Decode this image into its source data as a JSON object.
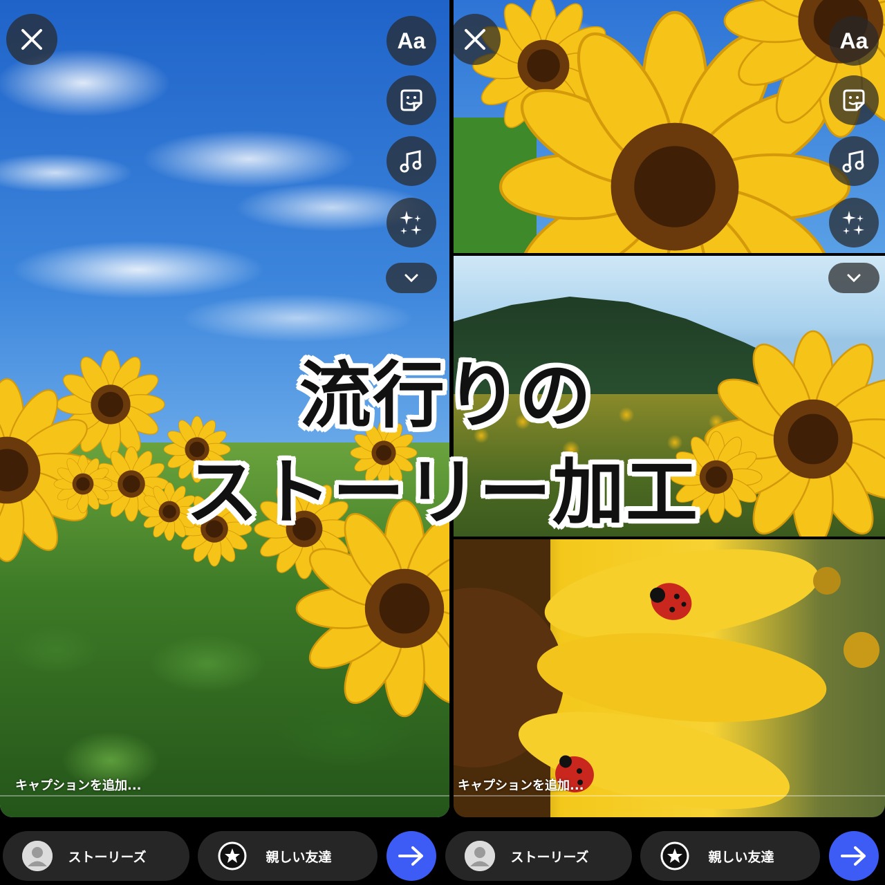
{
  "title": {
    "line1": "流行りの",
    "line2": "ストーリー加工"
  },
  "panels": [
    {
      "close_icon": "close-icon",
      "tools": [
        "text-icon",
        "sticker-icon",
        "music-icon",
        "effects-icon"
      ],
      "text_tool_label": "Aa",
      "more_icon": "chevron-down-icon",
      "caption_placeholder": "キャプションを追加..."
    },
    {
      "close_icon": "close-icon",
      "tools": [
        "text-icon",
        "sticker-icon",
        "music-icon",
        "effects-icon"
      ],
      "text_tool_label": "Aa",
      "more_icon": "chevron-down-icon",
      "caption_placeholder": "キャプションを追加..."
    }
  ],
  "bottom_bars": [
    {
      "stories_label": "ストーリーズ",
      "close_friends_label": "親しい友達",
      "send_icon": "arrow-right-icon"
    },
    {
      "stories_label": "ストーリーズ",
      "close_friends_label": "親しい友達",
      "send_icon": "arrow-right-icon"
    }
  ],
  "colors": {
    "send_button": "#3d5bf5",
    "pill_background": "#262626",
    "overlay_button": "rgba(40,40,40,0.72)"
  }
}
